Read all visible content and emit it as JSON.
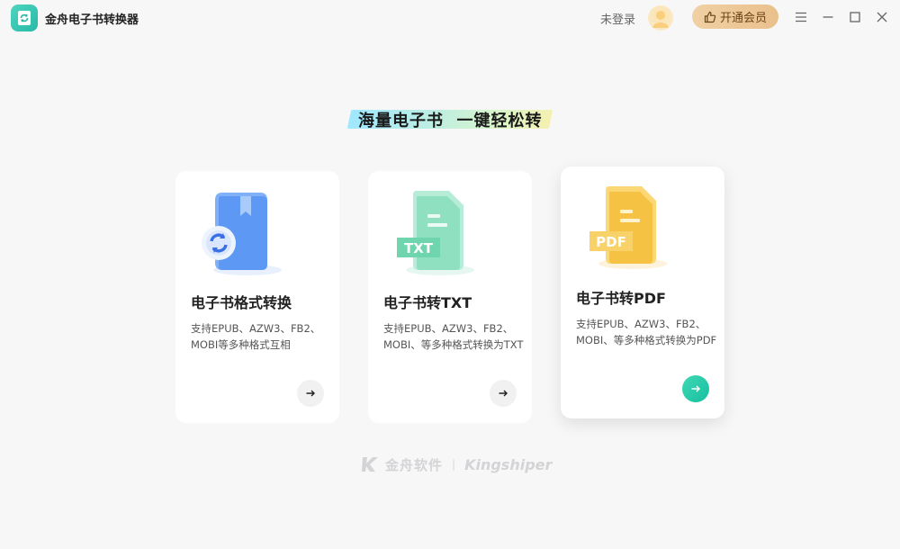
{
  "app": {
    "title": "金舟电子书转换器",
    "logo_icon": "book-sync-icon",
    "accent": "#2ec4a8"
  },
  "titlebar": {
    "login_label": "未登录",
    "vip_label": "开通会员",
    "vip_icon": "thumbs-up-icon",
    "menu_icon": "menu-icon",
    "minimize_icon": "minimize-icon",
    "maximize_icon": "maximize-icon",
    "close_icon": "close-icon"
  },
  "headline": "海量电子书  一键轻松转",
  "cards": [
    {
      "title": "电子书格式转换",
      "desc": "支持EPUB、AZW3、FB2、MOBI等多种格式互相",
      "icon": "blue-book-convert-icon",
      "arrow_icon": "arrow-right-icon",
      "color": "#4c8cf5"
    },
    {
      "title": "电子书转TXT",
      "desc": "支持EPUB、AZW3、FB2、MOBI、等多种格式转换为TXT",
      "icon": "green-txt-file-icon",
      "icon_text": "TXT",
      "arrow_icon": "arrow-right-icon",
      "color": "#5fd2b0"
    },
    {
      "title": "电子书转PDF",
      "desc": "支持EPUB、AZW3、FB2、MOBI、等多种格式转换为PDF",
      "icon": "yellow-pdf-file-icon",
      "icon_text": "PDF",
      "arrow_icon": "arrow-right-icon",
      "color": "#f6c244"
    }
  ],
  "footer": {
    "brand_cn": "金舟软件",
    "brand_en": "Kingshiper",
    "separator": "|",
    "logo_icon": "k-logo-icon"
  }
}
